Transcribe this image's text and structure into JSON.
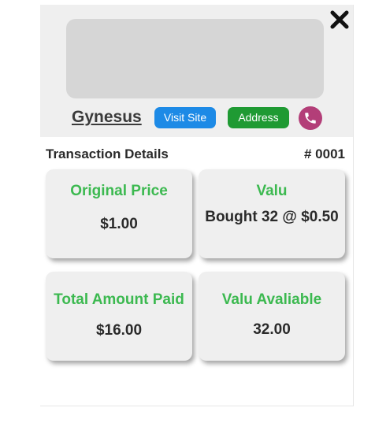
{
  "business": {
    "name": "Gynesus",
    "visit_site_label": "Visit Site",
    "address_label": "Address"
  },
  "transaction": {
    "title": "Transaction Details",
    "number": "# 0001"
  },
  "cards": [
    {
      "label": "Original Price",
      "value": "$1.00"
    },
    {
      "label": "Valu",
      "value": "Bought 32 @ $0.50"
    },
    {
      "label": "Total Amount Paid",
      "value": "$16.00"
    },
    {
      "label": "Valu Avaliable",
      "value": "32.00"
    }
  ],
  "icons": {
    "close": "close-icon",
    "phone": "phone-icon"
  },
  "colors": {
    "visit_button": "#1d8ae6",
    "address_button": "#1f9a33",
    "phone_button": "#b33e78",
    "card_label": "#3cb950"
  }
}
